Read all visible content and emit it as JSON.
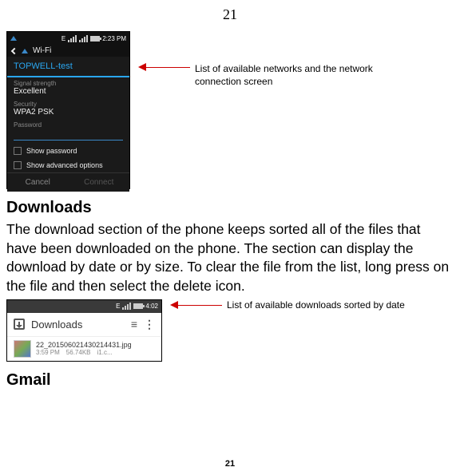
{
  "page_number_top": "21",
  "page_number_bottom": "21",
  "wifi_screen": {
    "status_time": "2:23 PM",
    "e_indicator": "E",
    "app_bar_label": "Wi-Fi",
    "dialog_title": "TOPWELL-test",
    "signal_label": "Signal strength",
    "signal_value": "Excellent",
    "security_label": "Security",
    "security_value": "WPA2 PSK",
    "password_label": "Password",
    "show_password": "Show password",
    "show_advanced": "Show advanced options",
    "btn_cancel": "Cancel",
    "btn_connect": "Connect"
  },
  "annotations": {
    "wifi": "List of available networks and the network connection screen",
    "downloads": "List of available downloads sorted by date"
  },
  "sections": {
    "downloads_heading": "Downloads",
    "downloads_body": "The download section of the phone keeps sorted all of the files that have been downloaded on the phone. The section can display the download by date or by size. To clear the file from the list, long press on the file and then select the delete icon.",
    "gmail_heading": "Gmail"
  },
  "downloads_screen": {
    "status_e": "E",
    "status_time": "4:02",
    "header_title": "Downloads",
    "item_filename": "22_201506021430214431.jpg",
    "item_time": "3:59 PM",
    "item_size": "56.74KB",
    "item_source": "i1.c..."
  }
}
